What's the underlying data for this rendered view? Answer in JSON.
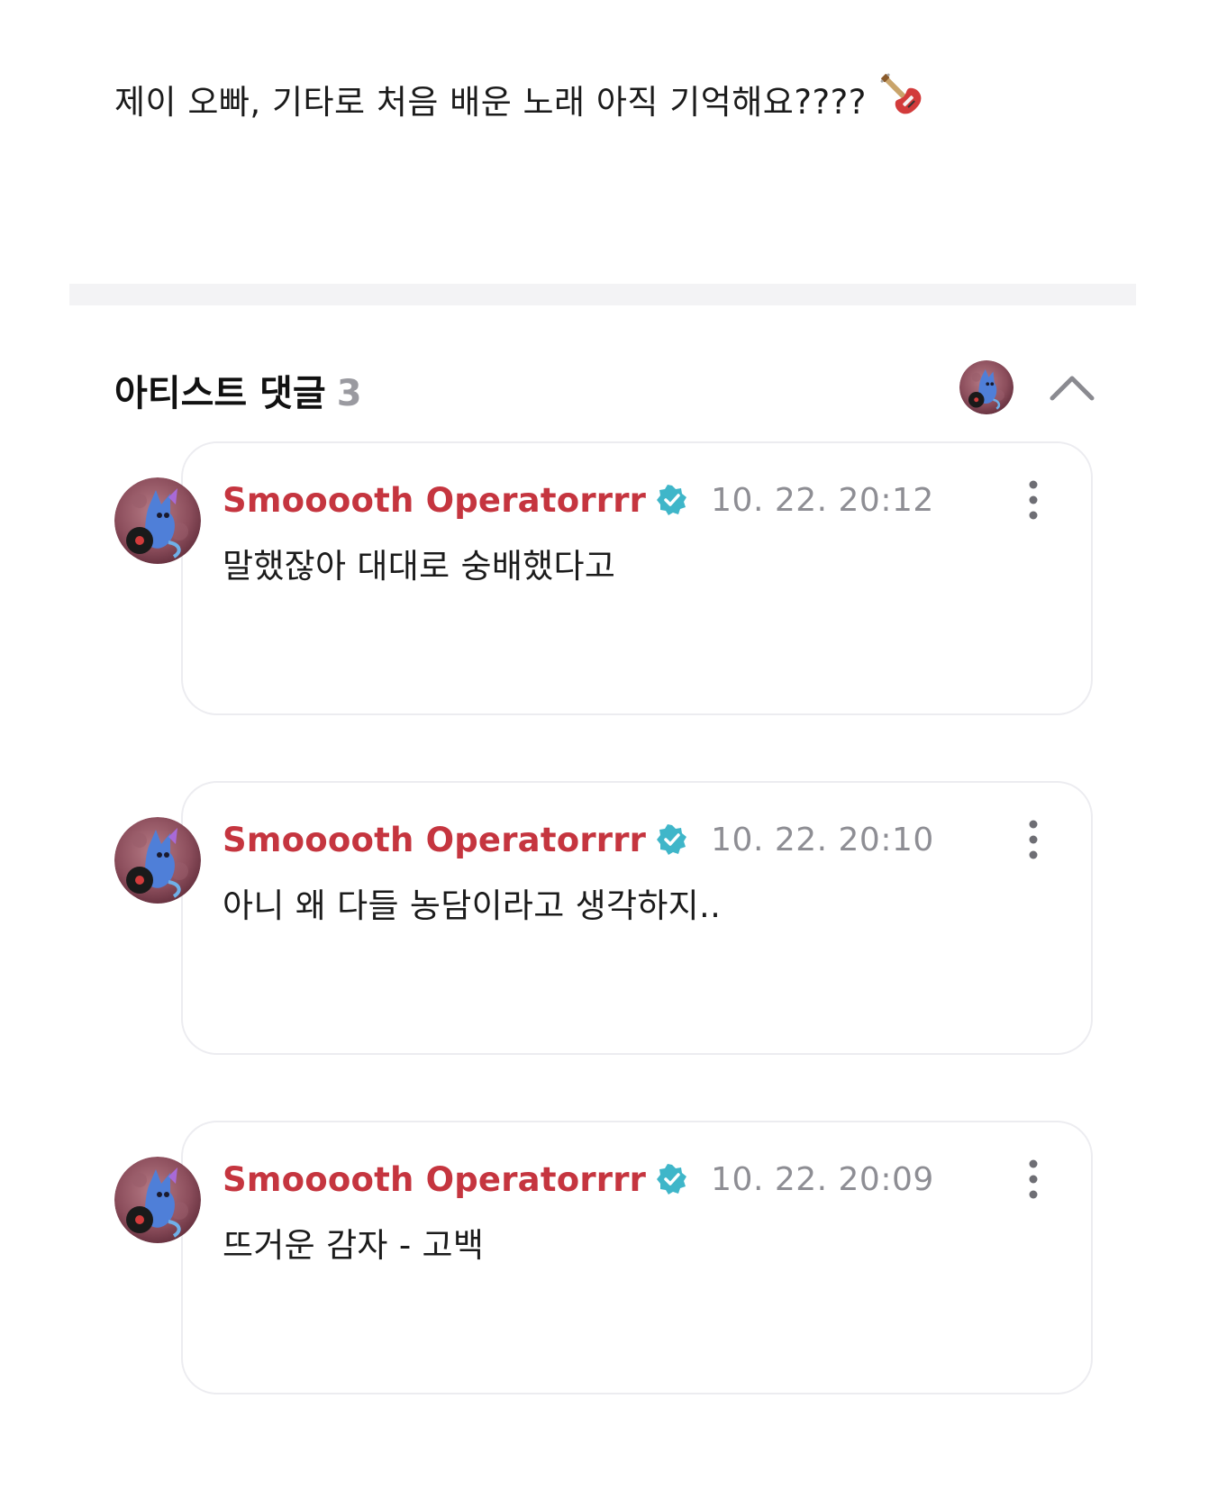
{
  "post": {
    "text": "제이 오빠, 기타로 처음 배운 노래 아직 기억해요????",
    "icon": "electric-guitar-icon"
  },
  "artist_comments": {
    "title": "아티스트 댓글",
    "count": "3",
    "collapse_icon": "chevron-up-icon",
    "comments": [
      {
        "author": "Smooooth Operatorrrr",
        "verified_icon": "verified-badge-icon",
        "timestamp": "10. 22. 20:12",
        "text": "말했잖아 대대로 숭배했다고",
        "menu_icon": "more-vertical-icon"
      },
      {
        "author": "Smooooth Operatorrrr",
        "verified_icon": "verified-badge-icon",
        "timestamp": "10. 22. 20:10",
        "text": "아니 왜 다들 농담이라고 생각하지..",
        "menu_icon": "more-vertical-icon"
      },
      {
        "author": "Smooooth Operatorrrr",
        "verified_icon": "verified-badge-icon",
        "timestamp": "10. 22. 20:09",
        "text": "뜨거운 감자 - 고백",
        "menu_icon": "more-vertical-icon"
      }
    ]
  },
  "colors": {
    "author_name": "#c5353f",
    "verified_badge": "#3fb6c9",
    "timestamp": "#8e8e94",
    "card_border": "#ececf0",
    "divider": "#f3f3f5"
  }
}
